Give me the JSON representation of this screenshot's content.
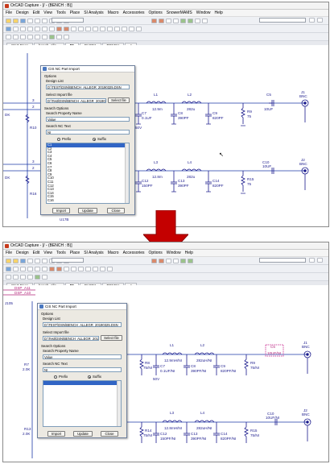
{
  "colors": {
    "wire": "#1e3aa8",
    "parts": "#1a1a8c",
    "net": "#b3247a",
    "arrow": "#c40000"
  },
  "top": {
    "title": "OrCAD Capture - [/ - (BENCH : B)]",
    "menu": [
      "File",
      "Design",
      "Edit",
      "View",
      "Tools",
      "Place",
      "SI Analysis",
      "Macro",
      "Accessories",
      "Options",
      "SnowerMAMS",
      "Window",
      "Help"
    ],
    "tabs": [
      "Start Page",
      "bench_alle...",
      "B*",
      "PAGE1",
      "BENCH",
      "A"
    ],
    "schematic": {
      "left_labels": [
        "3",
        "2",
        "3",
        "2"
      ],
      "left_refs": [
        "R10",
        "R16"
      ],
      "left_nets": [
        "DK",
        "DK"
      ],
      "parts_row1": [
        {
          "ref": "L1",
          "val": "12.9m"
        },
        {
          "ref": "L2",
          "val": "282u"
        },
        {
          "ref": "C8",
          "val": "390PF"
        },
        {
          "ref": "C9",
          "val": "820PF"
        },
        {
          "ref": "R9",
          "val": "75"
        },
        {
          "ref": "C5",
          "val": "10UF"
        },
        {
          "ref": "J1",
          "val": "BNC"
        },
        {
          "ref": "C7",
          "val": "0.1UF"
        },
        {
          "ref": "",
          "val": "50V"
        }
      ],
      "parts_row2": [
        {
          "ref": "L3",
          "val": "12.8m"
        },
        {
          "ref": "L4",
          "val": "282u"
        },
        {
          "ref": "C12",
          "val": "150PF"
        },
        {
          "ref": "C13",
          "val": "390PF"
        },
        {
          "ref": "C14",
          "val": "820PF"
        },
        {
          "ref": "R15",
          "val": "75"
        },
        {
          "ref": "C10",
          "val": "10UF"
        },
        {
          "ref": "J2",
          "val": "BNC"
        }
      ],
      "bottom_ref": "U17B"
    },
    "dialog": {
      "title": "CIS NC Part Import",
      "options_label": "Options",
      "design_list_label": "Design List",
      "design_list_value": "D:\\TEST\\DSN\\BENCH_ALLEGR_20190325.DSN",
      "import_file_label": "Select Import file",
      "import_file_value": "D:\\Test\\DSN\\BENCH_ALLEGR_201903",
      "select_file_button": "Select file",
      "search_options_label": "Search Options",
      "search_property_label": "Search Property Name",
      "search_property_value": "Value",
      "search_nc_label": "Search NC Text",
      "search_nc_value": "NI",
      "radio_prefix": "Prefix",
      "radio_suffix": "Suffix",
      "list_items": [
        "C1",
        "C2",
        "C3",
        "C4",
        "C5",
        "C6",
        "C7",
        "C8",
        "C9",
        "C10",
        "C11",
        "C12",
        "C13",
        "C14",
        "C15",
        "C16"
      ],
      "selected_index": 0,
      "import_button": "Import",
      "update_button": "Update",
      "close_button": "Close"
    }
  },
  "bottom": {
    "title": "OrCAD Capture - [/ - (BENCH : B)]",
    "menu": [
      "File",
      "Design",
      "Edit",
      "View",
      "Tools",
      "Place",
      "SI Analysis",
      "Macro",
      "Accessories",
      "Options",
      "Window",
      "Help"
    ],
    "tabs": [
      "Start Page",
      "bench_alle...",
      "B*",
      "PAGE1",
      "BENCH",
      "A"
    ],
    "schematic": {
      "top_nets": [
        "DSP_A11",
        "DSP_A10"
      ],
      "left_ref": "J105",
      "left_labels": [
        "R7",
        "2.0K",
        "R13",
        "2.0K"
      ],
      "parts_row1": [
        {
          "ref": "L1",
          "val": "12.9mH/NI"
        },
        {
          "ref": "L2",
          "val": "282uH/NI"
        },
        {
          "ref": "R8",
          "val": "75/NI"
        },
        {
          "ref": "C7",
          "val": "0.1UF/NI"
        },
        {
          "ref": "C8",
          "val": "390PF/NI"
        },
        {
          "ref": "C9",
          "val": "820PF/NI"
        },
        {
          "ref": "R9",
          "val": "75/NI"
        },
        {
          "ref": "C5",
          "val": "10UF/NI"
        },
        {
          "ref": "J1",
          "val": "BNC"
        },
        {
          "ref": "",
          "val": "50V"
        }
      ],
      "parts_row2": [
        {
          "ref": "L3",
          "val": "12.8mH/NI"
        },
        {
          "ref": "L4",
          "val": "282uH/NI"
        },
        {
          "ref": "R14",
          "val": "75/NI"
        },
        {
          "ref": "C12",
          "val": "150PF/NI"
        },
        {
          "ref": "C13",
          "val": "390PF/NI"
        },
        {
          "ref": "C14",
          "val": "820PF/NI"
        },
        {
          "ref": "R15",
          "val": "75/NI"
        },
        {
          "ref": "C10",
          "val": "10UF/NI"
        },
        {
          "ref": "J2",
          "val": "BNC"
        }
      ]
    },
    "dialog": {
      "title": "CIS NC Part Import",
      "options_label": "Options",
      "design_list_label": "Design List",
      "design_list_value": "D:\\TEST\\DSN\\BENCH_ALLEGR_20190325.DSN",
      "import_file_label": "Select Import file",
      "import_file_value": "D:\\Test\\DSN\\BENCH_ALLEGR_201903",
      "select_file_button": "Select file",
      "search_options_label": "Search Options",
      "search_property_label": "Search Property Name",
      "search_property_value": "Value",
      "search_nc_label": "Search NC Text",
      "search_nc_value": "NI",
      "radio_prefix": "Prefix",
      "radio_suffix": "Suffix",
      "import_button": "Import",
      "update_button": "Update",
      "close_button": "Close"
    }
  }
}
